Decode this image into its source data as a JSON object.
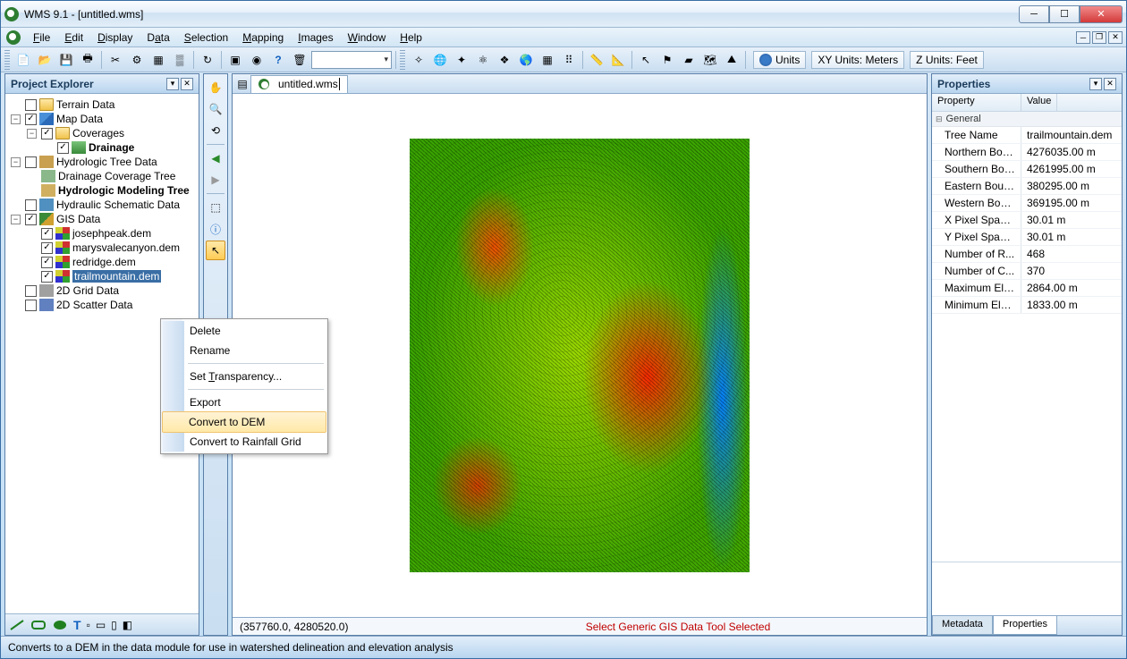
{
  "window": {
    "title": "WMS 9.1 - [untitled.wms]"
  },
  "menu": {
    "file": "File",
    "edit": "Edit",
    "display": "Display",
    "data": "Data",
    "selection": "Selection",
    "mapping": "Mapping",
    "images": "Images",
    "window": "Window",
    "help": "Help"
  },
  "toolbar_units": {
    "units": "Units",
    "xy": "XY Units: Meters",
    "z": "Z Units: Feet"
  },
  "explorer": {
    "title": "Project Explorer",
    "terrain": "Terrain Data",
    "mapdata": "Map Data",
    "coverages": "Coverages",
    "drainage": "Drainage",
    "hydrotree": "Hydrologic Tree Data",
    "drainage_cov_tree": "Drainage Coverage Tree",
    "hydro_model_tree": "Hydrologic Modeling Tree",
    "hydraulic": "Hydraulic Schematic Data",
    "gis": "GIS Data",
    "dem1": "josephpeak.dem",
    "dem2": "marysvalecanyon.dem",
    "dem3": "redridge.dem",
    "dem4": "trailmountain.dem",
    "grid2d": "2D Grid Data",
    "scatter2d": "2D Scatter Data"
  },
  "context": {
    "delete": "Delete",
    "rename": "Rename",
    "transparency": "Set Transparency...",
    "export": "Export",
    "convert_dem": "Convert to DEM",
    "convert_rain": "Convert to Rainfall Grid"
  },
  "tabs": {
    "file": "untitled.wms"
  },
  "status": {
    "coord": "(357760.0, 4280520.0)",
    "message": "Select Generic GIS Data Tool Selected"
  },
  "properties": {
    "title": "Properties",
    "col1": "Property",
    "col2": "Value",
    "category": "General",
    "rows": [
      {
        "k": "Tree Name",
        "v": "trailmountain.dem"
      },
      {
        "k": "Northern Bou...",
        "v": "4276035.00 m"
      },
      {
        "k": "Southern Bou...",
        "v": "4261995.00 m"
      },
      {
        "k": "Eastern Boun...",
        "v": "380295.00 m"
      },
      {
        "k": "Western Bou...",
        "v": "369195.00 m"
      },
      {
        "k": "X Pixel Spacing",
        "v": "30.01 m"
      },
      {
        "k": "Y Pixel Spacing",
        "v": "30.01 m"
      },
      {
        "k": "Number of R...",
        "v": "468"
      },
      {
        "k": "Number of C...",
        "v": "370"
      },
      {
        "k": "Maximum Ele...",
        "v": "2864.00 m"
      },
      {
        "k": "Minimum Ele...",
        "v": "1833.00 m"
      }
    ],
    "tab_meta": "Metadata",
    "tab_props": "Properties"
  },
  "statusbar": {
    "text": "Converts to a DEM in the data module for use in watershed delineation and elevation analysis"
  }
}
